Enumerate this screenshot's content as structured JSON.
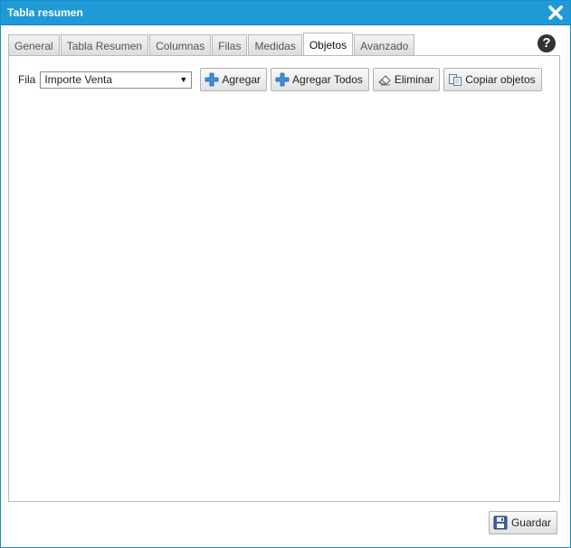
{
  "window": {
    "title": "Tabla resumen",
    "accent_color": "#1e9ad6"
  },
  "tabs": [
    {
      "label": "General",
      "active": false
    },
    {
      "label": "Tabla Resumen",
      "active": false
    },
    {
      "label": "Columnas",
      "active": false
    },
    {
      "label": "Filas",
      "active": false
    },
    {
      "label": "Medidas",
      "active": false
    },
    {
      "label": "Objetos",
      "active": true
    },
    {
      "label": "Avanzado",
      "active": false
    }
  ],
  "help": {
    "symbol": "?",
    "icon": "help-icon"
  },
  "toolbar": {
    "fila_label": "Fila",
    "fila_select_value": "Importe Venta",
    "add_label": "Agregar",
    "add_all_label": "Agregar Todos",
    "delete_label": "Eliminar",
    "copy_label": "Copiar objetos"
  },
  "footer": {
    "save_label": "Guardar"
  }
}
